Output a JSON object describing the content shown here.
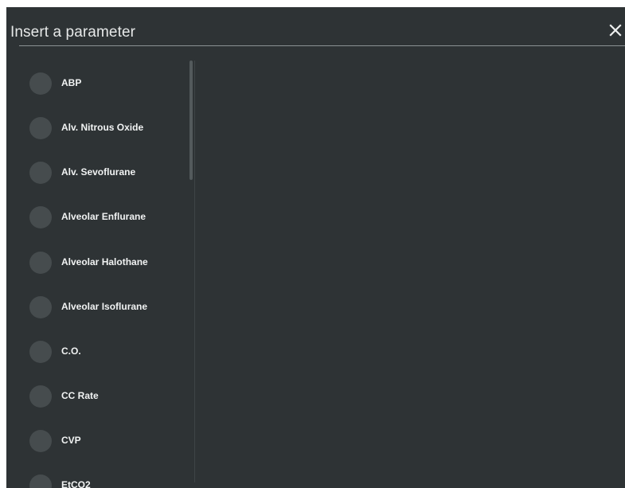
{
  "dialog": {
    "title": "Insert a parameter",
    "close_icon": "close-icon"
  },
  "parameters": [
    {
      "label": "ABP"
    },
    {
      "label": "Alv. Nitrous Oxide"
    },
    {
      "label": "Alv. Sevoflurane"
    },
    {
      "label": "Alveolar Enflurane"
    },
    {
      "label": "Alveolar Halothane"
    },
    {
      "label": "Alveolar Isoflurane"
    },
    {
      "label": "C.O."
    },
    {
      "label": "CC Rate"
    },
    {
      "label": "CVP"
    },
    {
      "label": "EtCO2"
    }
  ],
  "colors": {
    "dialog_bg": "#2e3335",
    "radio_bg": "#464c4e",
    "text": "#f1f3f3",
    "divider": "#8b9294"
  }
}
